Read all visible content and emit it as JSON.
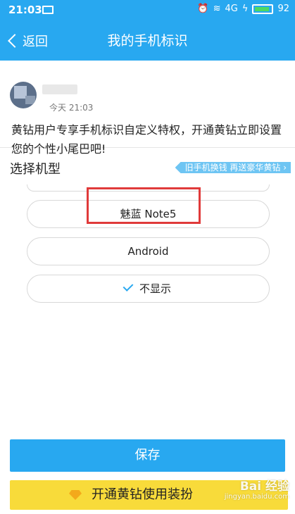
{
  "status_bar": {
    "time": "21:03",
    "network": "4G",
    "battery": "92"
  },
  "nav": {
    "back_label": "返回",
    "title": "我的手机标识"
  },
  "preview": {
    "time": "今天 21:03",
    "message": "黄钻用户专享手机标识自定义特权，开通黄钻立即设置您的个性小尾巴吧!"
  },
  "select": {
    "title": "选择机型",
    "promo": "旧手机换钱 再送豪华黄钻 ›"
  },
  "models": [
    {
      "label": "魅蓝 Note5",
      "selected": false
    },
    {
      "label": "Android",
      "selected": false
    },
    {
      "label": "不显示",
      "selected": true
    }
  ],
  "buttons": {
    "save": "保存",
    "vip": "开通黄钻使用装扮"
  },
  "watermark": {
    "brand": "Bai 经验",
    "url": "jingyan.baidu.com"
  },
  "colors": {
    "accent": "#28a8f0",
    "vip": "#f8db3a",
    "highlight": "#e03a3a"
  }
}
